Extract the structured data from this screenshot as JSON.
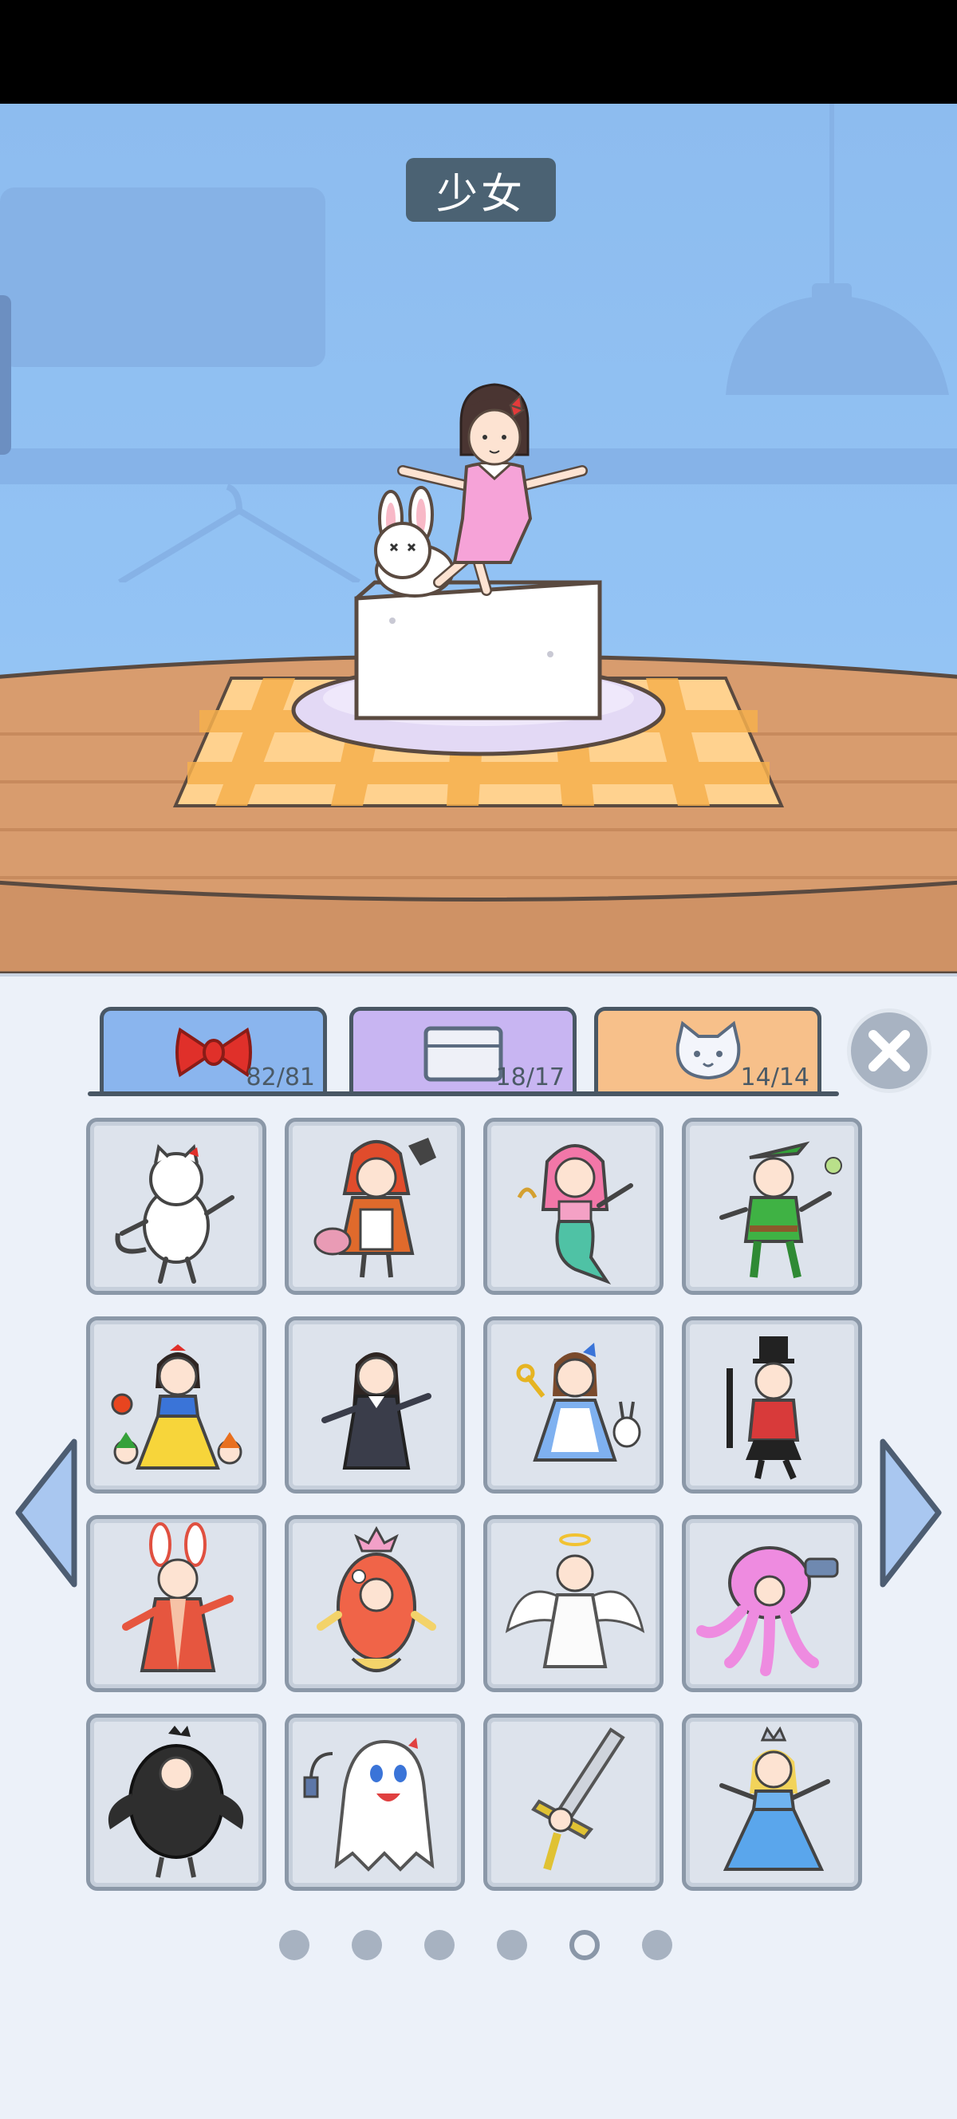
{
  "scene": {
    "title": "少女"
  },
  "tabs": [
    {
      "icon": "bow-icon",
      "count": "82/81",
      "color": "#8ab5ee"
    },
    {
      "icon": "plate-icon",
      "count": "18/17",
      "color": "#c8b5f2"
    },
    {
      "icon": "cat-icon",
      "count": "14/14",
      "color": "#f7c08a"
    }
  ],
  "costumes": [
    {
      "icon": "cat-costume-icon"
    },
    {
      "icon": "red-riding-hood-costume-icon"
    },
    {
      "icon": "mermaid-costume-icon"
    },
    {
      "icon": "peter-pan-costume-icon"
    },
    {
      "icon": "snow-white-costume-icon"
    },
    {
      "icon": "wednesday-costume-icon"
    },
    {
      "icon": "alice-costume-icon"
    },
    {
      "icon": "ringmaster-costume-icon"
    },
    {
      "icon": "bunny-hanfu-costume-icon"
    },
    {
      "icon": "goldfish-costume-icon"
    },
    {
      "icon": "angel-costume-icon"
    },
    {
      "icon": "octopus-costume-icon"
    },
    {
      "icon": "black-chicken-costume-icon"
    },
    {
      "icon": "ghost-costume-icon"
    },
    {
      "icon": "sword-costume-icon"
    },
    {
      "icon": "cinderella-costume-icon"
    }
  ],
  "pagination": {
    "total": 6,
    "current": 5
  },
  "colors": {
    "wall": "#93c3f4",
    "table": "#d89c6e",
    "panel": "#ecf1f9",
    "tile_border": "#8b98a8"
  }
}
